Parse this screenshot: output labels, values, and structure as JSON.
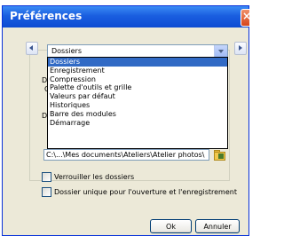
{
  "window": {
    "title": "Préférences"
  },
  "nav": {
    "prev_icon": "chevron-left-icon",
    "next_icon": "chevron-right-icon"
  },
  "category": {
    "selected": "Dossiers",
    "options": [
      "Dossiers",
      "Enregistrement",
      "Compression",
      "Palette d'outils et grille",
      "Valeurs par défaut",
      "Historiques",
      "Barre des modules",
      "Démarrage"
    ]
  },
  "folders": {
    "path_value": "C:\\...\\Mes documents\\Ateliers\\Atelier photos\\",
    "stub_a": "D",
    "stub_b": "C",
    "stub_c": "D"
  },
  "options": {
    "lock_folders": "Verrouiller les dossiers",
    "single_folder": "Dossier unique pour l'ouverture et l'enregistrement"
  },
  "buttons": {
    "ok": "Ok",
    "cancel": "Annuler"
  },
  "colors": {
    "title_bar": "#0d4bd2",
    "selection": "#316ac5",
    "dialog_bg": "#ece9d8"
  }
}
